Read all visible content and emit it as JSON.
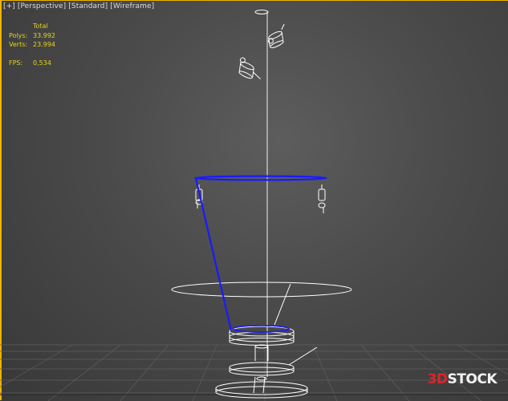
{
  "viewport": {
    "label_parts": [
      "[+]",
      "[Perspective]",
      "[Standard]",
      "[Wireframe]"
    ]
  },
  "stats": {
    "header": "Total",
    "polys_label": "Polys:",
    "polys_value": "33.992",
    "verts_label": "Verts:",
    "verts_value": "23.994",
    "fps_label": "FPS:",
    "fps_value": "0,534"
  },
  "watermark": {
    "prefix": "3D",
    "suffix": "STOCK"
  },
  "colors": {
    "viewport_border": "#f0b400",
    "stats_text": "#e8d31a",
    "wireframe": "#ffffff",
    "selection": "#1a1aff",
    "watermark_accent": "#d8262c"
  }
}
